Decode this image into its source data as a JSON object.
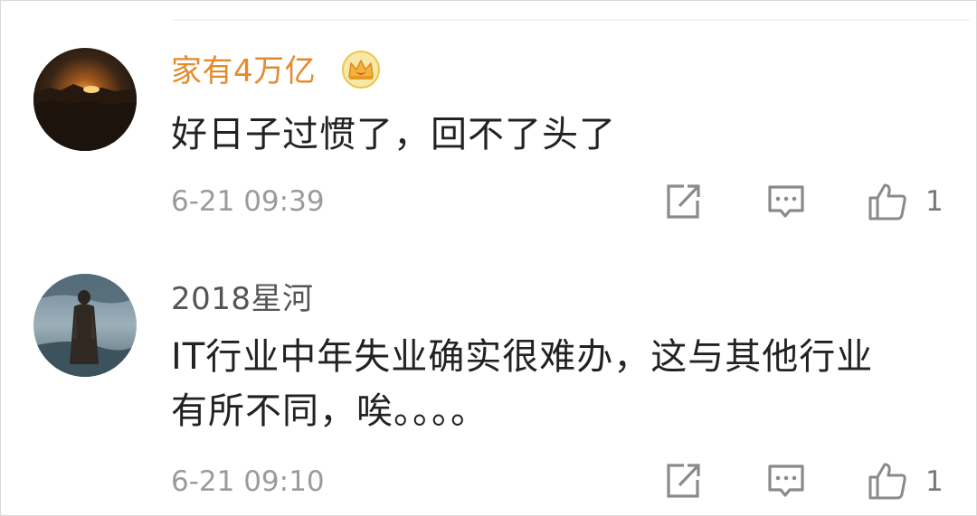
{
  "comments": [
    {
      "username": "家有4万亿",
      "username_color": "#e58a2b",
      "has_crown_badge": true,
      "avatar": "sunset-landscape-avatar",
      "text_lines": [
        "好日子过惯了，回不了头了"
      ],
      "timestamp": "6-21 09:39",
      "likes": "1"
    },
    {
      "username": "2018星河",
      "username_color": "#555555",
      "has_crown_badge": false,
      "avatar": "standing-figure-avatar",
      "text_lines": [
        "IT行业中年失业确实很难办，这与其他行业",
        "有所不同，唉。。。。"
      ],
      "timestamp": "6-21 09:10",
      "likes": "1"
    }
  ],
  "icons": {
    "forward": "share-forward-icon",
    "reply": "comment-reply-icon",
    "like": "thumbs-up-icon",
    "crown": "crown-badge-icon"
  },
  "colors": {
    "icon_stroke": "#8a8a8a",
    "text": "#222222",
    "muted": "#9b9b9b"
  }
}
